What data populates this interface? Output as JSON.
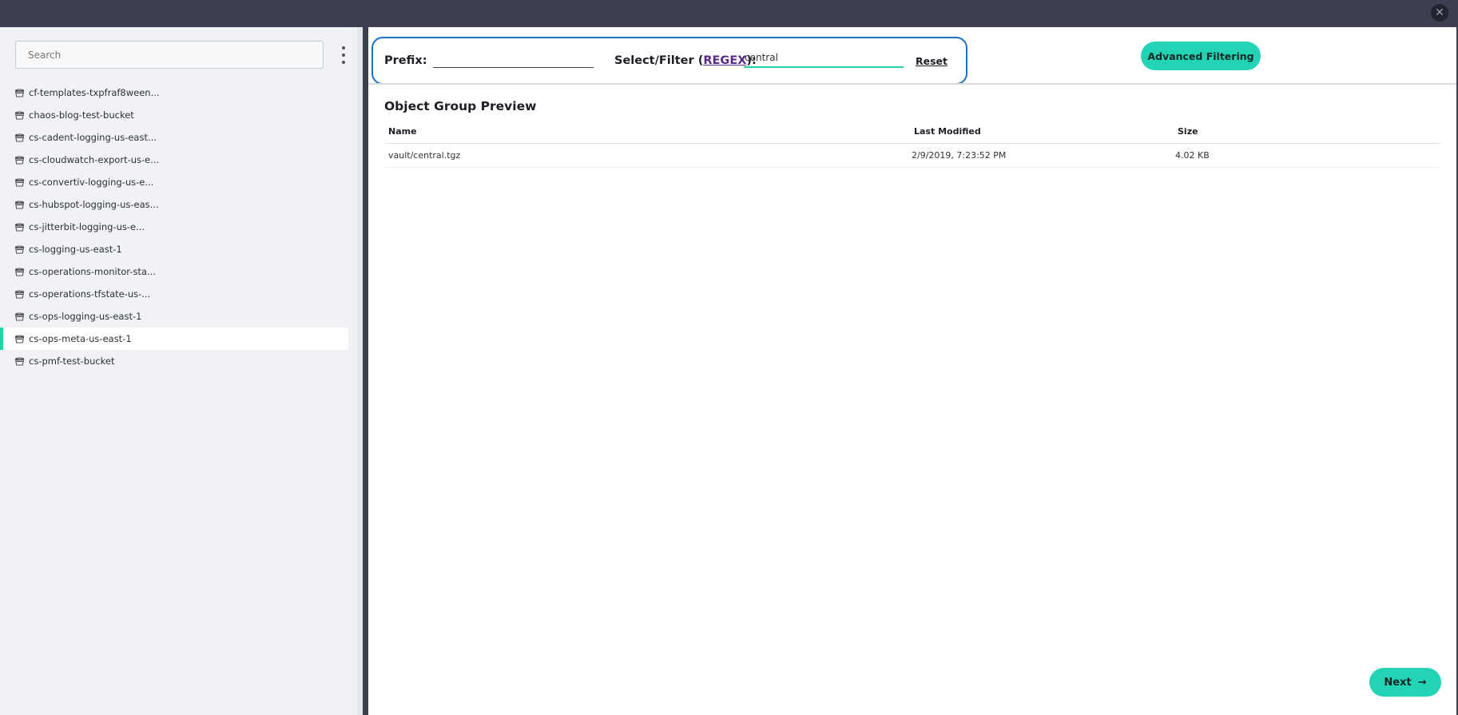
{
  "window": {
    "close_label": "✕"
  },
  "sidebar": {
    "search": {
      "placeholder": "Search",
      "value": ""
    },
    "buckets": [
      "cf-templates-txpfraf8ween...",
      "chaos-blog-test-bucket",
      "cs-cadent-logging-us-east...",
      "cs-cloudwatch-export-us-e...",
      "cs-convertiv-logging-us-e...",
      "cs-hubspot-logging-us-eas...",
      "cs-jitterbit-logging-us-e...",
      "cs-logging-us-east-1",
      "cs-operations-monitor-sta...",
      "cs-operations-tfstate-us-...",
      "cs-ops-logging-us-east-1",
      "cs-ops-meta-us-east-1",
      "cs-pmf-test-bucket"
    ],
    "selected_index": 11
  },
  "filter": {
    "prefix_label": "Prefix:",
    "prefix_value": "",
    "select_label_before": "Select/Filter (",
    "regex_link": "REGEX",
    "select_label_after": "):",
    "filter_value": "central",
    "reset_label": "Reset"
  },
  "advanced_button": "Advanced Filtering",
  "preview": {
    "title": "Object Group Preview",
    "columns": [
      "Name",
      "Last Modified",
      "Size"
    ],
    "rows": [
      {
        "name": "vault/central.tgz",
        "modified": "2/9/2019, 7:23:52 PM",
        "size": "4.02 KB"
      }
    ]
  },
  "next_button": {
    "label": "Next",
    "arrow": "→"
  },
  "colors": {
    "accent": "#22d3b6",
    "focus_border": "#1f6fc5",
    "selected_marker": "#22d3a5"
  }
}
